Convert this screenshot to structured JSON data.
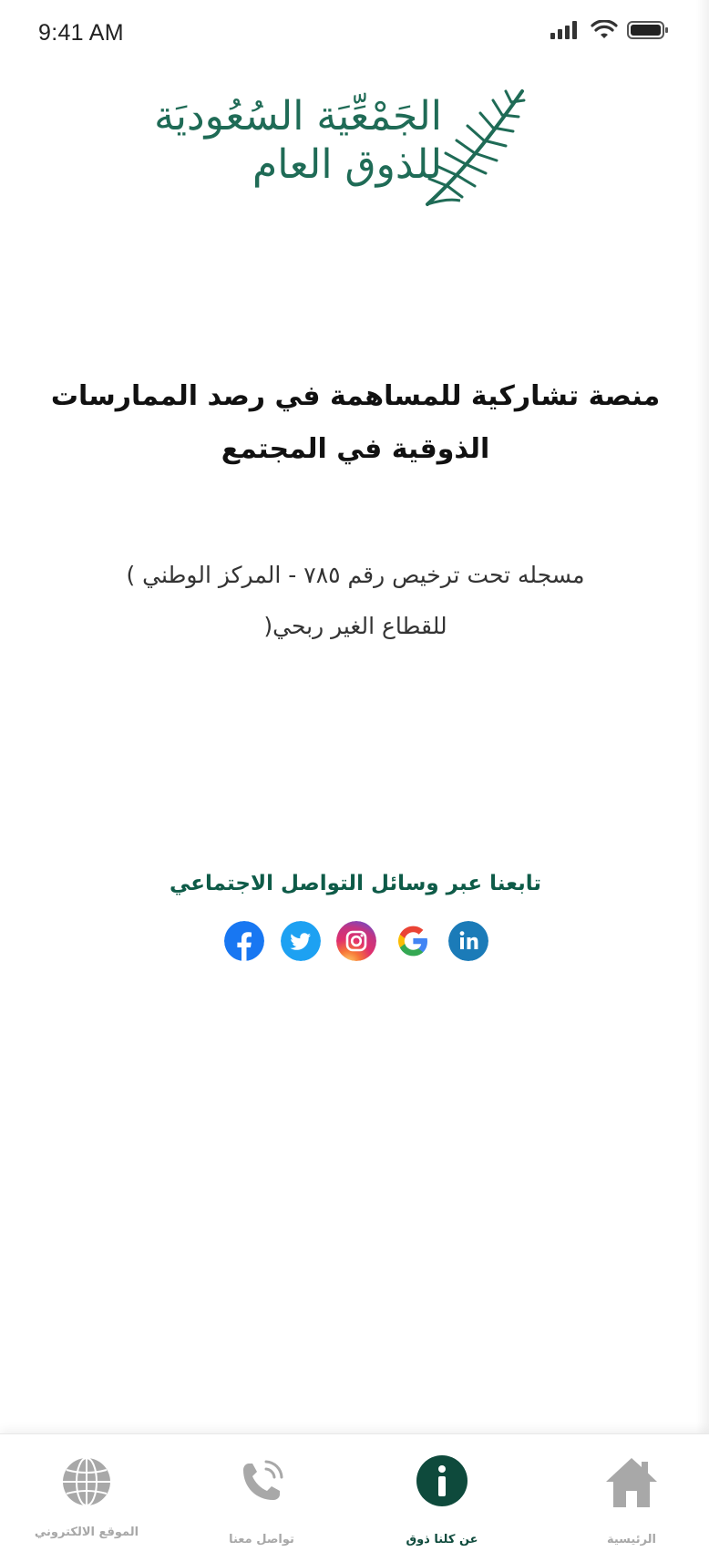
{
  "status_bar": {
    "time": "9:41 AM"
  },
  "logo": {
    "line1": "الجَمْعِّيَة السُعُوديَة",
    "line2": "للذوق العام",
    "icon": "palm-frond-icon"
  },
  "main": {
    "headline_line1": "منصة تشاركية للمساهمة في رصد الممارسات",
    "headline_line2": "الذوقية في المجتمع",
    "subtitle_line1": "مسجله تحت ترخيص رقم ٧٨٥ - المركز الوطني )",
    "subtitle_line2": "للقطاع الغير ربحي("
  },
  "social": {
    "follow_label": "تابعنا عبر وسائل التواصل الاجتماعي",
    "icons": [
      "facebook-icon",
      "twitter-icon",
      "instagram-icon",
      "google-icon",
      "linkedin-icon"
    ]
  },
  "bottom_nav": {
    "items": [
      {
        "label": "الموقع الالكتروني",
        "icon": "globe-icon",
        "active": false
      },
      {
        "label": "تواصل معنا",
        "icon": "phone-icon",
        "active": false
      },
      {
        "label": "عن كلنا ذوق",
        "icon": "info-icon",
        "active": true
      },
      {
        "label": "الرئيسية",
        "icon": "home-icon",
        "active": false
      }
    ]
  },
  "colors": {
    "brand_green": "#1f6b56",
    "dark_green": "#0e4a3c",
    "inactive_gray": "#a8a8a8"
  }
}
